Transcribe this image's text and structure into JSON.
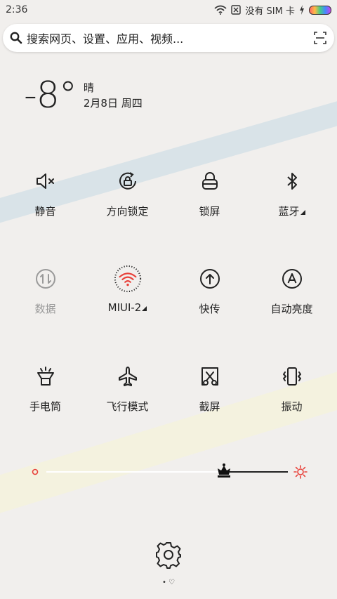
{
  "status_bar": {
    "time": "2:36",
    "sim_status": "没有 SIM 卡"
  },
  "search": {
    "placeholder": "搜索网页、设置、应用、视频..."
  },
  "weather": {
    "temperature": "-8°",
    "condition": "晴",
    "date": "2月8日 周四"
  },
  "toggles": {
    "row1": [
      {
        "label": "静音",
        "icon": "mute-icon"
      },
      {
        "label": "方向锁定",
        "icon": "rotation-lock-icon"
      },
      {
        "label": "锁屏",
        "icon": "lock-icon"
      },
      {
        "label": "蓝牙",
        "icon": "bluetooth-icon"
      }
    ],
    "row2": [
      {
        "label": "数据",
        "icon": "mobile-data-icon"
      },
      {
        "label": "MIUI-2",
        "icon": "wifi-icon"
      },
      {
        "label": "快传",
        "icon": "transfer-icon"
      },
      {
        "label": "自动亮度",
        "icon": "auto-brightness-icon"
      }
    ],
    "row3": [
      {
        "label": "手电筒",
        "icon": "flashlight-icon"
      },
      {
        "label": "飞行模式",
        "icon": "airplane-icon"
      },
      {
        "label": "截屏",
        "icon": "screenshot-icon"
      },
      {
        "label": "振动",
        "icon": "vibrate-icon"
      }
    ]
  },
  "brightness": {
    "level": 0.7
  },
  "pager": {
    "indicator": "• ♡"
  },
  "colors": {
    "accent": "#e8413a",
    "background": "#f1efed"
  }
}
